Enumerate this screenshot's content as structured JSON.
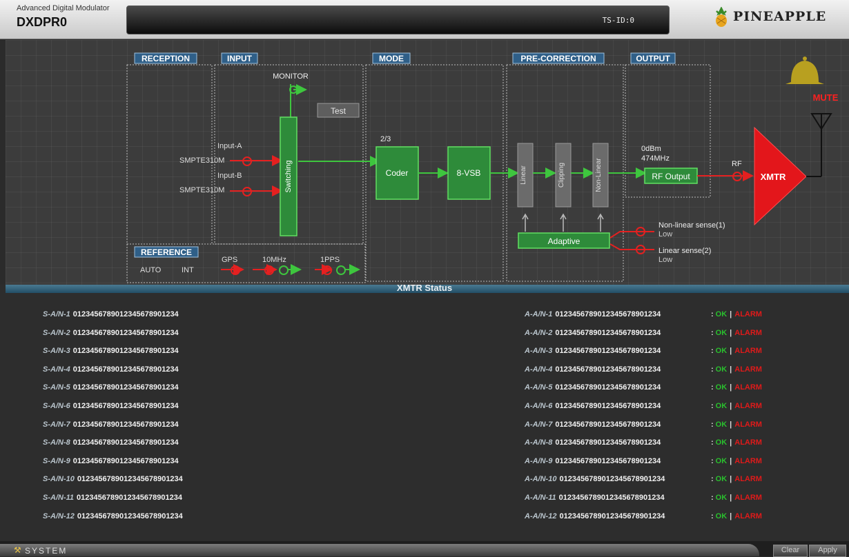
{
  "header": {
    "product_subtitle": "Advanced Digital Modulator",
    "product_name": "DXDPR0",
    "ts_id": "TS-ID:0",
    "brand": "PINEAPPLE"
  },
  "diagram": {
    "sections": {
      "reception": "RECEPTION",
      "input": "INPUT",
      "mode": "MODE",
      "precorrection": "PRE-CORRECTION",
      "output": "OUTPUT",
      "reference": "REFERENCE"
    },
    "monitor_label": "MONITOR",
    "test_button": "Test",
    "input_a_label": "Input-A",
    "input_a_signal": "SMPTE310M",
    "input_b_label": "Input-B",
    "input_b_signal": "SMPTE310M",
    "switching": "Switching",
    "code_rate": "2/3",
    "coder": "Coder",
    "vsb": "8-VSB",
    "linear": "Linear",
    "clipping": "Clipping",
    "nonlinear": "Non-Linear",
    "adaptive": "Adaptive",
    "output_power": "0dBm",
    "output_freq": "474MHz",
    "rf_output": "RF Output",
    "rf_label": "RF",
    "xmtr": "XMTR",
    "mute": "MUTE",
    "nonlinear_sense": "Non-linear sense(1)",
    "nonlinear_sense_state": "Low",
    "linear_sense": "Linear sense(2)",
    "linear_sense_state": "Low",
    "ref_mode": "AUTO",
    "ref_source": "INT",
    "gps": "GPS",
    "mhz10": "10MHz",
    "pps": "1PPS"
  },
  "status": {
    "title": "XMTR Status",
    "s_rows": [
      {
        "label": "S-A/N-1",
        "value": "0123456789012345678901234"
      },
      {
        "label": "S-A/N-2",
        "value": "0123456789012345678901234"
      },
      {
        "label": "S-A/N-3",
        "value": "0123456789012345678901234"
      },
      {
        "label": "S-A/N-4",
        "value": "0123456789012345678901234"
      },
      {
        "label": "S-A/N-5",
        "value": "0123456789012345678901234"
      },
      {
        "label": "S-A/N-6",
        "value": "0123456789012345678901234"
      },
      {
        "label": "S-A/N-7",
        "value": "0123456789012345678901234"
      },
      {
        "label": "S-A/N-8",
        "value": "0123456789012345678901234"
      },
      {
        "label": "S-A/N-9",
        "value": "0123456789012345678901234"
      },
      {
        "label": "S-A/N-10",
        "value": "0123456789012345678901234"
      },
      {
        "label": "S-A/N-11",
        "value": "0123456789012345678901234"
      },
      {
        "label": "S-A/N-12",
        "value": "0123456789012345678901234"
      }
    ],
    "a_rows": [
      {
        "label": "A-A/N-1",
        "value": "0123456789012345678901234"
      },
      {
        "label": "A-A/N-2",
        "value": "0123456789012345678901234"
      },
      {
        "label": "A-A/N-3",
        "value": "0123456789012345678901234"
      },
      {
        "label": "A-A/N-4",
        "value": "0123456789012345678901234"
      },
      {
        "label": "A-A/N-5",
        "value": "0123456789012345678901234"
      },
      {
        "label": "A-A/N-6",
        "value": "0123456789012345678901234"
      },
      {
        "label": "A-A/N-7",
        "value": "0123456789012345678901234"
      },
      {
        "label": "A-A/N-8",
        "value": "0123456789012345678901234"
      },
      {
        "label": "A-A/N-9",
        "value": "0123456789012345678901234"
      },
      {
        "label": "A-A/N-10",
        "value": "0123456789012345678901234"
      },
      {
        "label": "A-A/N-11",
        "value": "0123456789012345678901234"
      },
      {
        "label": "A-A/N-12",
        "value": "0123456789012345678901234"
      }
    ],
    "prefix": ":",
    "ok_label": "OK",
    "separator": "|",
    "alarm_label": "ALARM"
  },
  "footer": {
    "system_label": "SYSTEM",
    "clear_button": "Clear",
    "apply_button": "Apply"
  },
  "colors": {
    "green_block": "#2e8b3a",
    "ok": "#29c02d",
    "alarm": "#e01a1a",
    "amplifier": "#e3161b",
    "section_label": "#2f5f88"
  }
}
